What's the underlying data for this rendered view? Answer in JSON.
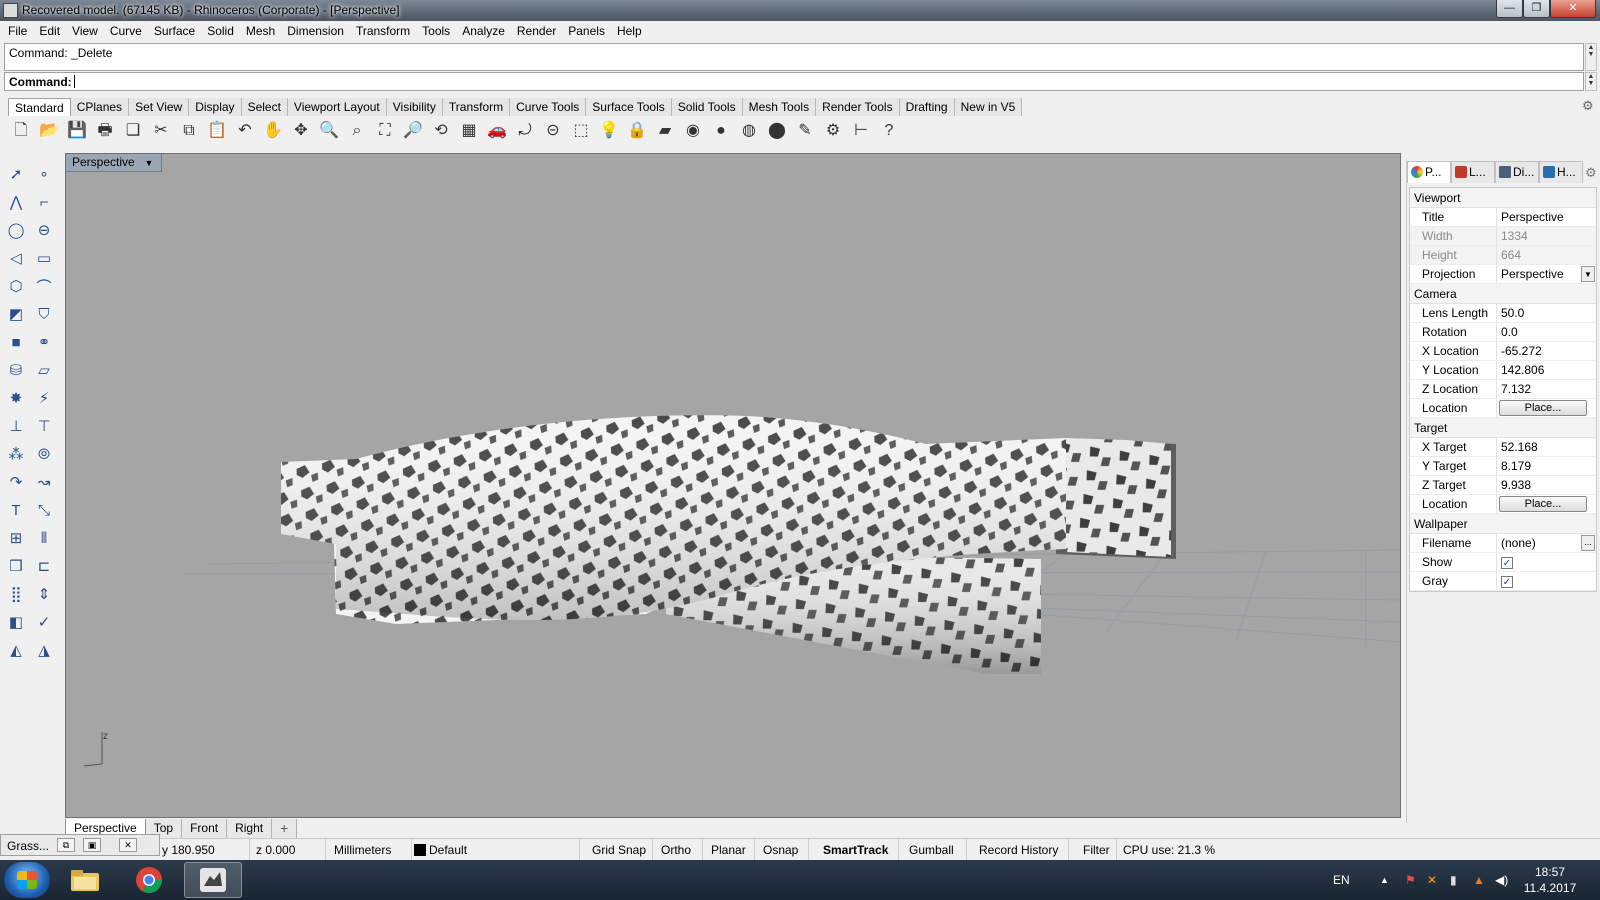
{
  "window": {
    "title": "Recovered model. (67145 KB) - Rhinoceros (Corporate) - [Perspective]",
    "min_glyph": "—",
    "max_glyph": "❐",
    "close_glyph": "✕"
  },
  "menu": [
    "File",
    "Edit",
    "View",
    "Curve",
    "Surface",
    "Solid",
    "Mesh",
    "Dimension",
    "Transform",
    "Tools",
    "Analyze",
    "Render",
    "Panels",
    "Help"
  ],
  "command": {
    "history": "Command: _Delete",
    "prompt": "Command:"
  },
  "toolbar_tabs": [
    "Standard",
    "CPlanes",
    "Set View",
    "Display",
    "Select",
    "Viewport Layout",
    "Visibility",
    "Transform",
    "Curve Tools",
    "Surface Tools",
    "Solid Tools",
    "Mesh Tools",
    "Render Tools",
    "Drafting",
    "New in V5"
  ],
  "main_toolbar": [
    {
      "name": "new-file-icon",
      "glyph": "🗋"
    },
    {
      "name": "open-folder-icon",
      "glyph": "📂"
    },
    {
      "name": "save-icon",
      "glyph": "💾"
    },
    {
      "name": "print-icon",
      "glyph": "🖶"
    },
    {
      "name": "copy-to-layer-icon",
      "glyph": "❏"
    },
    {
      "name": "cut-icon",
      "glyph": "✂"
    },
    {
      "name": "copy-icon",
      "glyph": "⧉"
    },
    {
      "name": "paste-icon",
      "glyph": "📋"
    },
    {
      "name": "undo-icon",
      "glyph": "↶"
    },
    {
      "name": "pan-hand-icon",
      "glyph": "✋"
    },
    {
      "name": "move-icon",
      "glyph": "✥"
    },
    {
      "name": "zoom-window-icon",
      "glyph": "🔍"
    },
    {
      "name": "zoom-dynamic-icon",
      "glyph": "⌕"
    },
    {
      "name": "zoom-extents-icon",
      "glyph": "⛶"
    },
    {
      "name": "zoom-selected-icon",
      "glyph": "🔎"
    },
    {
      "name": "rotate-view-icon",
      "glyph": "⟲"
    },
    {
      "name": "four-viewports-icon",
      "glyph": "▦"
    },
    {
      "name": "car-icon",
      "glyph": "🚗"
    },
    {
      "name": "rotate-dashed-icon",
      "glyph": "⤾"
    },
    {
      "name": "osnap-icon",
      "glyph": "⊝"
    },
    {
      "name": "cplane-icon",
      "glyph": "⬚"
    },
    {
      "name": "light-bulb-icon",
      "glyph": "💡"
    },
    {
      "name": "lock-icon",
      "glyph": "🔒"
    },
    {
      "name": "layer-icon",
      "glyph": "▰"
    },
    {
      "name": "color-wheel-icon",
      "glyph": "◉"
    },
    {
      "name": "shaded-sphere-icon",
      "glyph": "●"
    },
    {
      "name": "rendered-sphere-icon",
      "glyph": "◍"
    },
    {
      "name": "render-sphere-icon",
      "glyph": "⬤"
    },
    {
      "name": "materials-icon",
      "glyph": "✎"
    },
    {
      "name": "gear-options-icon",
      "glyph": "⚙"
    },
    {
      "name": "dimension-icon",
      "glyph": "⊢"
    },
    {
      "name": "help-icon",
      "glyph": "?"
    }
  ],
  "left_toolbar": [
    {
      "name": "select-arrow-icon",
      "glyph": "➚"
    },
    {
      "name": "point-icon",
      "glyph": "∘"
    },
    {
      "name": "polyline-icon",
      "glyph": "⋀"
    },
    {
      "name": "curve-control-points-icon",
      "glyph": "⌐"
    },
    {
      "name": "circle-icon",
      "glyph": "◯"
    },
    {
      "name": "ellipse-icon",
      "glyph": "⊖"
    },
    {
      "name": "arc-icon",
      "glyph": "◁"
    },
    {
      "name": "rectangle-icon",
      "glyph": "▭"
    },
    {
      "name": "polygon-icon",
      "glyph": "⬡"
    },
    {
      "name": "fillet-curve-icon",
      "glyph": "⌒"
    },
    {
      "name": "surface-corner-icon",
      "glyph": "◩"
    },
    {
      "name": "sweep-surface-icon",
      "glyph": "⛉"
    },
    {
      "name": "box-solid-icon",
      "glyph": "■"
    },
    {
      "name": "boolean-union-icon",
      "glyph": "⚭"
    },
    {
      "name": "cylinder-mesh-icon",
      "glyph": "⛁"
    },
    {
      "name": "mesh-plane-icon",
      "glyph": "▱"
    },
    {
      "name": "explode-icon",
      "glyph": "✸"
    },
    {
      "name": "trim-icon",
      "glyph": "⚡"
    },
    {
      "name": "split-icon",
      "glyph": "⊥"
    },
    {
      "name": "join-icon",
      "glyph": "⊤"
    },
    {
      "name": "group-icon",
      "glyph": "⁂"
    },
    {
      "name": "ungroup-icon",
      "glyph": "⦾"
    },
    {
      "name": "offset-icon",
      "glyph": "↷"
    },
    {
      "name": "extend-icon",
      "glyph": "↝"
    },
    {
      "name": "text-icon",
      "glyph": "T"
    },
    {
      "name": "scale-icon",
      "glyph": "⤡"
    },
    {
      "name": "array-icon",
      "glyph": "⊞"
    },
    {
      "name": "mirror-icon",
      "glyph": "⫴"
    },
    {
      "name": "box-edit-icon",
      "glyph": "❒"
    },
    {
      "name": "dimension-linear-icon",
      "glyph": "⊏"
    },
    {
      "name": "grid-array-icon",
      "glyph": "⣿"
    },
    {
      "name": "distance-icon",
      "glyph": "⇕"
    },
    {
      "name": "analyze-surface-icon",
      "glyph": "◧"
    },
    {
      "name": "check-icon",
      "glyph": "✓"
    },
    {
      "name": "mesh-tools-icon",
      "glyph": "◭"
    },
    {
      "name": "render-tools-icon",
      "glyph": "◮"
    }
  ],
  "viewport": {
    "label": "Perspective",
    "dropdown_glyph": "▼",
    "axis_label": "z"
  },
  "viewport_tabs": [
    "Perspective",
    "Top",
    "Front",
    "Right"
  ],
  "viewport_add_glyph": "+",
  "panel_tabs": [
    {
      "label": "P...",
      "color": "#d9342b"
    },
    {
      "label": "L...",
      "color": "#c0392b"
    },
    {
      "label": "Di...",
      "color": "#4a5f7a"
    },
    {
      "label": "H...",
      "color": "#2b6cb0"
    }
  ],
  "panel_gear_glyph": "⚙",
  "properties": {
    "viewport_title": "Viewport",
    "title_label": "Title",
    "title_value": "Perspective",
    "width_label": "Width",
    "width_value": "1334",
    "height_label": "Height",
    "height_value": "664",
    "projection_label": "Projection",
    "projection_value": "Perspective",
    "camera_title": "Camera",
    "lens_label": "Lens Length",
    "lens_value": "50.0",
    "rotation_label": "Rotation",
    "rotation_value": "0.0",
    "xloc_label": "X Location",
    "xloc_value": "-65.272",
    "yloc_label": "Y Location",
    "yloc_value": "142.806",
    "zloc_label": "Z Location",
    "zloc_value": "7.132",
    "cam_location_label": "Location",
    "cam_location_button": "Place...",
    "target_title": "Target",
    "xt_label": "X Target",
    "xt_value": "52.168",
    "yt_label": "Y Target",
    "yt_value": "8.179",
    "zt_label": "Z Target",
    "zt_value": "9.938",
    "tgt_location_label": "Location",
    "tgt_location_button": "Place...",
    "wallpaper_title": "Wallpaper",
    "filename_label": "Filename",
    "filename_value": "(none)",
    "filename_button": "...",
    "show_label": "Show",
    "show_checked": "✓",
    "gray_label": "Gray",
    "gray_checked": "✓"
  },
  "grasshopper": {
    "title": "Grass...",
    "btn1": "⧉",
    "btn2": "▣",
    "btn3": "✕"
  },
  "status": {
    "y": "y 180.950",
    "z": "z 0.000",
    "units": "Millimeters",
    "layer": "Default",
    "grid_snap": "Grid Snap",
    "ortho": "Ortho",
    "planar": "Planar",
    "osnap": "Osnap",
    "smarttrack": "SmartTrack",
    "gumball": "Gumball",
    "record_history": "Record History",
    "filter": "Filter",
    "cpu": "CPU use: 21.3 %"
  },
  "taskbar": {
    "lang": "EN",
    "time": "18:57",
    "date": "11.4.2017"
  }
}
